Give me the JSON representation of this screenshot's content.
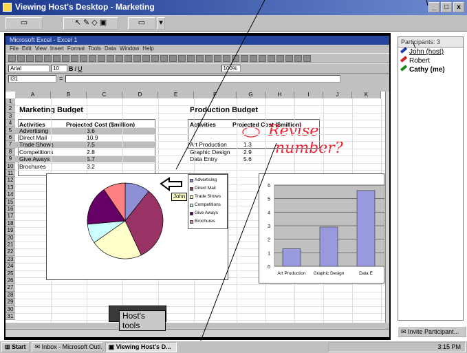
{
  "window": {
    "title": "Viewing Host's Desktop - Marketing"
  },
  "excel": {
    "title": "Microsoft Excel - Excel 1",
    "menu": [
      "File",
      "Edit",
      "View",
      "Insert",
      "Format",
      "Tools",
      "Data",
      "Window",
      "Help"
    ],
    "font": "Arial",
    "font_size": "10",
    "zoom": "100%",
    "cell_ref": "I31",
    "columns": [
      "A",
      "B",
      "C",
      "D",
      "E",
      "F",
      "G",
      "H",
      "I",
      "J",
      "K"
    ],
    "marketing": {
      "title": "Marketing Budget",
      "hdr_activities": "Activities",
      "hdr_cost": "Projected Cost ($million)",
      "rows": [
        {
          "label": "Advertising",
          "value": "3.6"
        },
        {
          "label": "Direct Mail",
          "value": "10.9"
        },
        {
          "label": "Trade Shows",
          "value": "7.5"
        },
        {
          "label": "Competitions",
          "value": "2.8"
        },
        {
          "label": "Give Aways",
          "value": "5.7"
        },
        {
          "label": "Brochures",
          "value": "3.2"
        }
      ]
    },
    "production": {
      "title": "Production Budget",
      "hdr_activities": "Activities",
      "hdr_cost": "Projected Cost ($million)",
      "rows": [
        {
          "label": "Art Production",
          "value": "1.3"
        },
        {
          "label": "Graphic Design",
          "value": "2.9"
        },
        {
          "label": "Data Entry",
          "value": "5.6"
        }
      ]
    },
    "annotation": {
      "line1": "Revise",
      "line2": "number?"
    }
  },
  "pie": {
    "legend": [
      "Advertising",
      "Direct Mail",
      "Trade Shows",
      "Competitions",
      "Give Aways",
      "Brochures"
    ],
    "values": [
      3.6,
      10.9,
      7.5,
      2.8,
      5.7,
      3.2
    ],
    "colors": [
      "#8f8fd6",
      "#993366",
      "#ffffcc",
      "#ccffff",
      "#660066",
      "#ff8080"
    ]
  },
  "bar": {
    "categories": [
      "Art Production",
      "Graphic Design",
      "Data E"
    ],
    "values": [
      1.3,
      2.9,
      5.6
    ],
    "yticks": [
      "0",
      "1",
      "2",
      "3",
      "4",
      "5",
      "6"
    ],
    "ymax": 6,
    "color": "#9999dd"
  },
  "pointer_label": "John",
  "host_tools": "Host's tools",
  "participants": {
    "title": "Participants: 3",
    "list": [
      {
        "name": "John (host)",
        "color": "#1a3bb0"
      },
      {
        "name": "Robert",
        "color": "#cc2222"
      },
      {
        "name": "Cathy (me)",
        "color": "#1a8a1a"
      }
    ]
  },
  "invite_label": "Invite Participant...",
  "taskbar": {
    "start": "Start",
    "items": [
      "Inbox - Microsoft Outl...",
      "Viewing Host's D..."
    ],
    "clock": "3:15 PM"
  }
}
